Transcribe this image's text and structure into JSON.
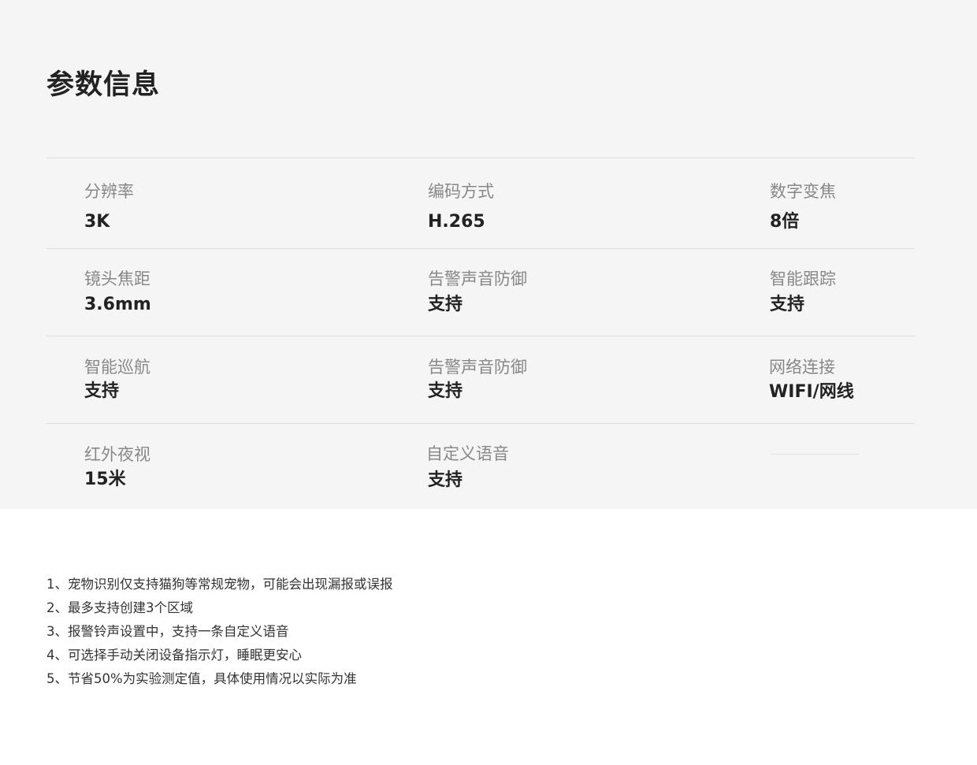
{
  "section_title": "参数信息",
  "specs": [
    [
      {
        "label": "分辨率",
        "value": "3K"
      },
      {
        "label": "编码方式",
        "value": "H.265"
      },
      {
        "label": "数字变焦",
        "value": "8倍"
      }
    ],
    [
      {
        "label": "镜头焦距",
        "value": "3.6mm"
      },
      {
        "label": "告警声音防御",
        "value": "支持"
      },
      {
        "label": "智能跟踪",
        "value": "支持"
      }
    ],
    [
      {
        "label": "智能巡航",
        "value": "支持"
      },
      {
        "label": "告警声音防御",
        "value": "支持"
      },
      {
        "label": "网络连接",
        "value": "WIFI/网线"
      }
    ],
    [
      {
        "label": "红外夜视",
        "value": "15米"
      },
      {
        "label": "自定义语音",
        "value": "支持"
      }
    ]
  ],
  "notes": [
    "1、宠物识别仅支持猫狗等常规宠物，可能会出现漏报或误报",
    "2、最多支持创建3个区域",
    "3、报警铃声设置中，支持一条自定义语音",
    "4、可选择手动关闭设备指示灯，睡眠更安心",
    "5、节省50%为实验测定值，具体使用情况以实际为准"
  ]
}
